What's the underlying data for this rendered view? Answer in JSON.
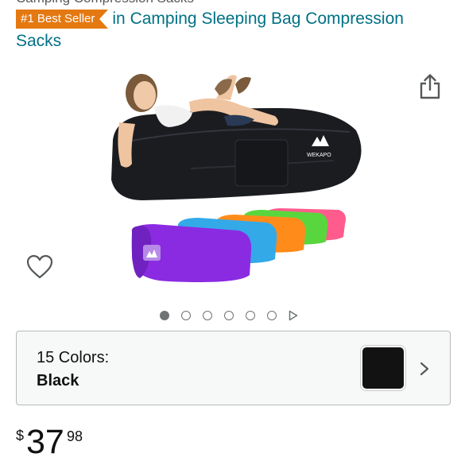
{
  "header": {
    "cut_text": "Camping Compression Sacks",
    "badge_label": "#1 Best Seller",
    "category_line": "in Camping Sleeping Bag Compression Sacks"
  },
  "product": {
    "brand_logo_text": "WEKAPO"
  },
  "carousel": {
    "total_images": 6,
    "active_index": 0
  },
  "variation": {
    "label": "15 Colors:",
    "selected_value": "Black",
    "swatch_color": "#121212"
  },
  "price": {
    "symbol": "$",
    "whole": "37",
    "fraction": "98"
  },
  "colors": {
    "badge": "#e47911",
    "link": "#007185",
    "sofa_colors": [
      "#8a2be2",
      "#34a9e8",
      "#ff8c1a",
      "#59d63e",
      "#ff5c8d"
    ]
  }
}
